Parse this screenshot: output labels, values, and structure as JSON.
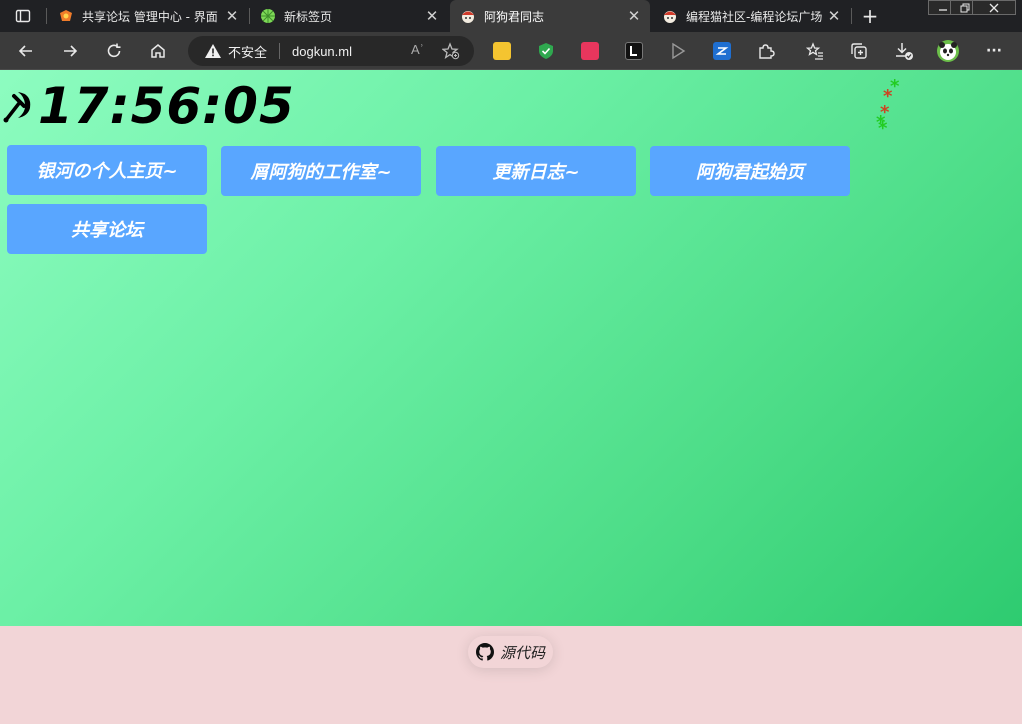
{
  "browser": {
    "tabs": [
      {
        "title": "共享论坛 管理中心 - 界面",
        "active": false
      },
      {
        "title": "新标签页",
        "active": false
      },
      {
        "title": "阿狗君同志",
        "active": true
      },
      {
        "title": "编程猫社区-编程论坛广场",
        "active": false
      }
    ],
    "close_glyph": "✕",
    "newtab_glyph": "+",
    "address": {
      "security_label": "不安全",
      "url": "dogkun.ml",
      "read_aloud_glyph": "Aʾ"
    },
    "menu_glyph": "···"
  },
  "page": {
    "clock_time": "17:56:05",
    "nav": [
      {
        "label": "银河の个人主页~"
      },
      {
        "label": "屑阿狗的工作室~"
      },
      {
        "label": "更新日志~"
      },
      {
        "label": "阿狗君起始页"
      },
      {
        "label": "共享论坛"
      }
    ],
    "snowflakes": [
      {
        "glyph": "*",
        "color": "#22cc22"
      },
      {
        "glyph": "*",
        "color": "#cc4422"
      },
      {
        "glyph": "*",
        "color": "#cc4422"
      },
      {
        "glyph": "*",
        "color": "#22cc22"
      },
      {
        "glyph": "*",
        "color": "#22cc22"
      }
    ]
  },
  "footer": {
    "source_label": "源代码"
  },
  "colors": {
    "button_bg": "#59a6ff",
    "footer_bg": "#f2d5d7",
    "page_gradient_start": "#8dfcc0",
    "page_gradient_end": "#2ecb70"
  }
}
